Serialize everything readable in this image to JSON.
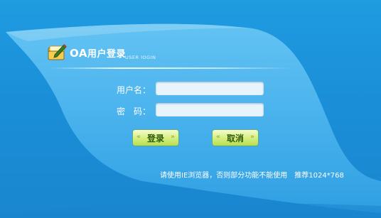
{
  "header": {
    "title_prefix": "OA",
    "title_suffix": "用户登录",
    "subtitle_en": "USER lOGIN"
  },
  "form": {
    "username_label": "用户名：",
    "username_value": "",
    "password_label": "密　码：",
    "password_value": ""
  },
  "buttons": {
    "login_label": "登录",
    "cancel_label": "取消",
    "chevron_left": "«",
    "chevron_right": "»"
  },
  "footer": {
    "browser_note": "请使用IE浏览器，否则部分功能不能使用　推荐1024*768"
  },
  "colors": {
    "background": "#1a8fd8",
    "panel": "#4fb6ef",
    "button": "#d7ef83",
    "icon_folder": "#f2c64a"
  },
  "icons": {
    "logo": "folder-pencil-icon"
  }
}
